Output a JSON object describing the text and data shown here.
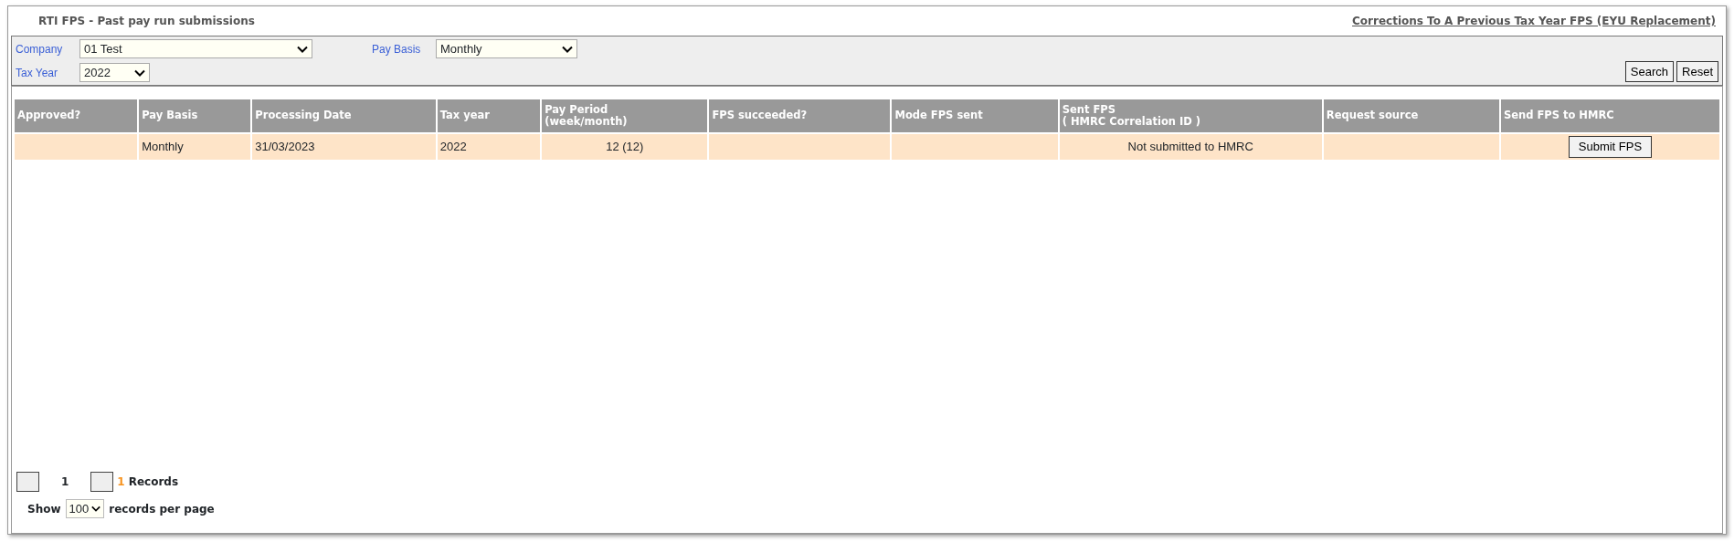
{
  "header": {
    "title": "RTI FPS - Past pay run submissions",
    "link": "Corrections To A Previous Tax Year FPS (EYU Replacement)"
  },
  "filters": [
    {
      "label": "Company",
      "value": "01 Test",
      "kind": "wide"
    },
    {
      "label": "Pay Basis",
      "value": "Monthly",
      "kind": "medium"
    },
    {
      "label": "Tax Year",
      "value": "2022",
      "kind": "narrow"
    }
  ],
  "filter_buttons": [
    "Search",
    "Reset"
  ],
  "table": {
    "columns": [
      {
        "label": "Approved?"
      },
      {
        "label": "Pay Basis"
      },
      {
        "label": "Processing Date"
      },
      {
        "label": "Tax year"
      },
      {
        "label": "Pay Period\n(week/month)"
      },
      {
        "label": "FPS succeeded?"
      },
      {
        "label": "Mode FPS sent"
      },
      {
        "label": "Sent FPS\n( HMRC Correlation ID )"
      },
      {
        "label": "Request source"
      },
      {
        "label": "Send FPS to HMRC"
      }
    ],
    "rows": [
      {
        "cells": [
          "",
          "Monthly",
          "31/03/2023",
          "2022",
          "12 (12)",
          "",
          "",
          "Not submitted to HMRC",
          "",
          ""
        ],
        "button": "Submit FPS"
      }
    ]
  },
  "pager": {
    "page": "1",
    "count": "1",
    "records_label": "Records",
    "show_label": "Show",
    "page_size": "100",
    "per_page_label": "records per page"
  }
}
